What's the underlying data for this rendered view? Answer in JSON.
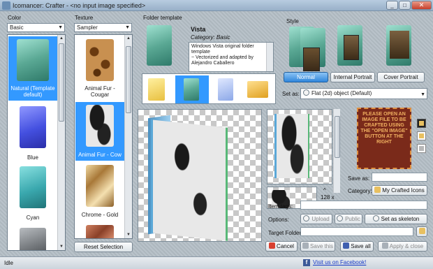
{
  "window": {
    "title": "Icomancer: Crafter - <no input image specified>",
    "close_glyph": "✕"
  },
  "color": {
    "label": "Color",
    "selected": "Basic",
    "items": [
      {
        "label": "Natural (Template default)",
        "icon": "folder-natural"
      },
      {
        "label": "Blue",
        "icon": "folder-blue"
      },
      {
        "label": "Cyan",
        "icon": "folder-cyan"
      },
      {
        "label": "",
        "icon": "folder-gray"
      }
    ]
  },
  "texture": {
    "label": "Texture",
    "selected": "Sampler",
    "items": [
      {
        "label": "Animal Fur - Cougar",
        "icon": "texture-cougar"
      },
      {
        "label": "Animal Fur - Cow",
        "icon": "texture-cow"
      },
      {
        "label": "Chrome - Gold",
        "icon": "texture-gold"
      },
      {
        "label": "",
        "icon": "texture-copper"
      }
    ],
    "reset_label": "Reset Selection"
  },
  "folder_template": {
    "label": "Folder template",
    "name": "Vista",
    "category": "Category: Basic",
    "description": "Windows Vista original folder template\n~ Vectorized and adapted by Alejandro Caballero"
  },
  "style": {
    "label": "Style",
    "buttons": [
      "Normal",
      "Internal Portrait",
      "Cover Portrait"
    ],
    "active": "Normal"
  },
  "set_as": {
    "label": "Set as:",
    "value": "Flat (2d) object (Default)"
  },
  "placeholder_message": "PLEASE OPEN AN IMAGE FILE TO BE CRAFTED USING THE \"OPEN IMAGE\" BUTTON AT THE RIGHT",
  "preview_size_label": "128 x",
  "size_up_arrow": "^",
  "save_as_label": "Save as:",
  "category": {
    "label": "Category:",
    "value": "My Crafted Icons"
  },
  "item_tags_label": "Item tags:",
  "options": {
    "label": "Options:",
    "upload": "Upload",
    "public": "Public",
    "set_as_skeleton": "Set as skeleton"
  },
  "target_folder_label": "Target Folder:",
  "actions": {
    "cancel": "Cancel",
    "save_this": "Save this",
    "save_all": "Save all",
    "apply_close": "Apply & close"
  },
  "status": {
    "text": "Idle",
    "facebook": "Visit us on Facebook!"
  },
  "colors": {
    "selection": "#3399ff",
    "message_bg": "#7a2a1a",
    "message_text": "#f0b060"
  }
}
